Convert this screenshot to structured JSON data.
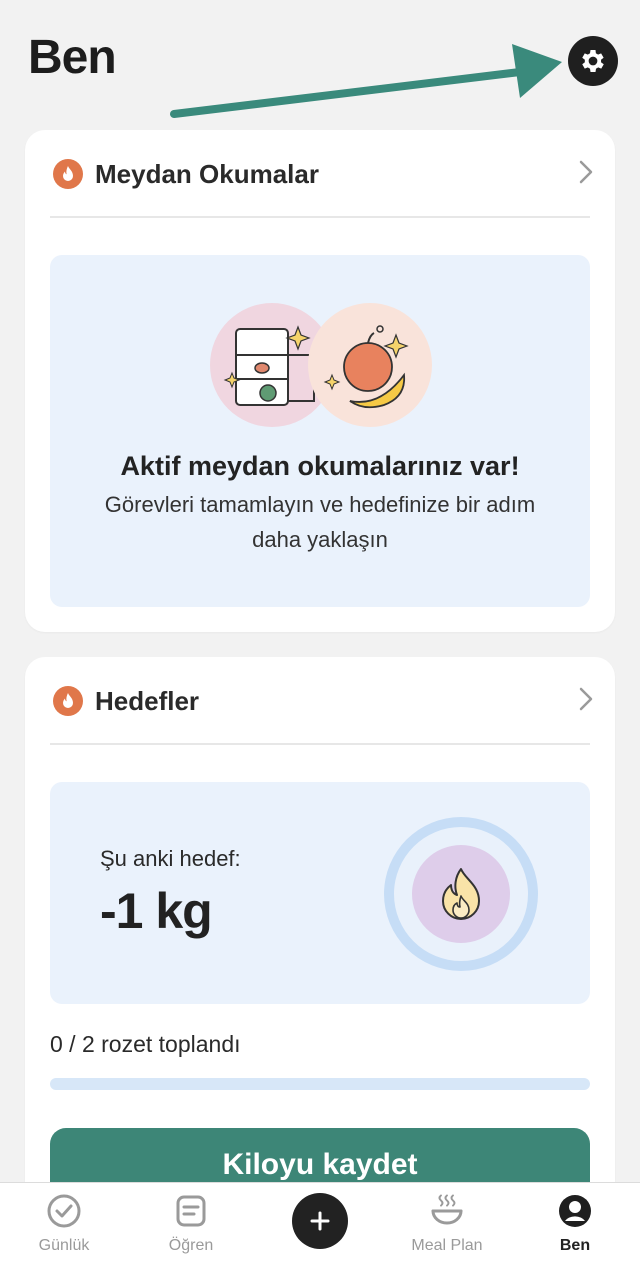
{
  "header": {
    "title": "Ben",
    "settings_icon": "gear-icon"
  },
  "challenges": {
    "title": "Meydan Okumalar",
    "heading": "Aktif meydan okumalarınız var!",
    "subtext": "Görevleri tamamlayın ve hedefinize bir adım daha yaklaşın"
  },
  "goals": {
    "title": "Hedefler",
    "current_label": "Şu anki hedef:",
    "current_value": "-1 kg",
    "badges_text": "0 / 2 rozet toplandı",
    "badges_progress": 0,
    "log_weight_label": "Kiloyu kaydet"
  },
  "tabbar": {
    "items": [
      {
        "label": "Günlük",
        "icon": "check-circle-icon"
      },
      {
        "label": "Öğren",
        "icon": "note-icon"
      },
      {
        "label": "",
        "icon": "plus-icon"
      },
      {
        "label": "Meal Plan",
        "icon": "bowl-icon"
      },
      {
        "label": "Ben",
        "icon": "profile-icon"
      }
    ],
    "active": "Ben"
  },
  "colors": {
    "accent": "#3d8677",
    "flame": "#e0774a",
    "panel": "#eaf2fc",
    "annotation_arrow": "#3a8a7c"
  }
}
